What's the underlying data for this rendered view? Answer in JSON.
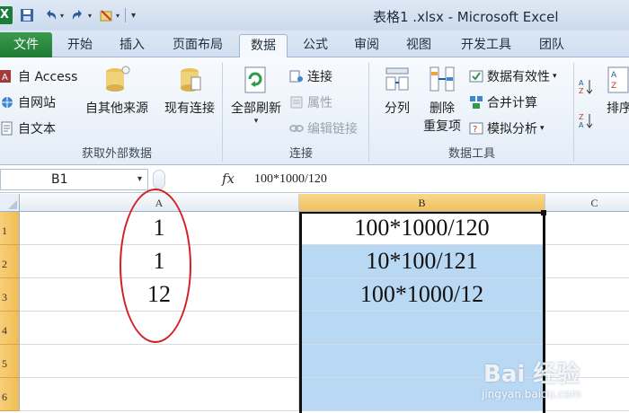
{
  "window": {
    "title": "表格1 .xlsx - Microsoft Excel"
  },
  "qat": {
    "logo": "X",
    "icons": [
      "save-icon",
      "undo-icon",
      "redo-icon",
      "format-icon"
    ]
  },
  "tabs": [
    {
      "label": "文件"
    },
    {
      "label": "开始"
    },
    {
      "label": "插入"
    },
    {
      "label": "页面布局"
    },
    {
      "label": "数据"
    },
    {
      "label": "公式"
    },
    {
      "label": "审阅"
    },
    {
      "label": "视图"
    },
    {
      "label": "开发工具"
    },
    {
      "label": "团队"
    }
  ],
  "active_tab": "数据",
  "ribbon": {
    "get_external": {
      "access": "自 Access",
      "web": "自网站",
      "text": "自文本",
      "other_sources": "自其他来源",
      "existing": "现有连接",
      "label": "获取外部数据"
    },
    "connections": {
      "refresh_all": "全部刷新",
      "connections": "连接",
      "properties": "属性",
      "edit_links": "编辑链接",
      "label": "连接"
    },
    "data_tools": {
      "split": "分列",
      "remove_dup_1": "删除",
      "remove_dup_2": "重复项",
      "validation": "数据有效性",
      "consolidate": "合并计算",
      "whatif": "模拟分析",
      "label": "数据工具"
    },
    "sort": {
      "sort_label": "排序"
    }
  },
  "formula_bar": {
    "name_box": "B1",
    "fx": "fx",
    "formula": "100*1000/120"
  },
  "sheet": {
    "columns": [
      "A",
      "B",
      "C"
    ],
    "rows": [
      {
        "num": "1",
        "a": "1",
        "b": "100*1000/120"
      },
      {
        "num": "2",
        "a": "1",
        "b": "10*100/121"
      },
      {
        "num": "3",
        "a": "12",
        "b": "100*1000/12"
      },
      {
        "num": "4",
        "a": "",
        "b": ""
      },
      {
        "num": "5",
        "a": "",
        "b": ""
      },
      {
        "num": "6",
        "a": "",
        "b": ""
      }
    ]
  },
  "watermark": {
    "main": "Bai 经验",
    "sub": "jingyan.baidu.com"
  },
  "colors": {
    "file_tab": "#1f7a33",
    "selection": "#b9d8f3",
    "annotation": "#d42020",
    "header_selected": "#f1c15f"
  }
}
